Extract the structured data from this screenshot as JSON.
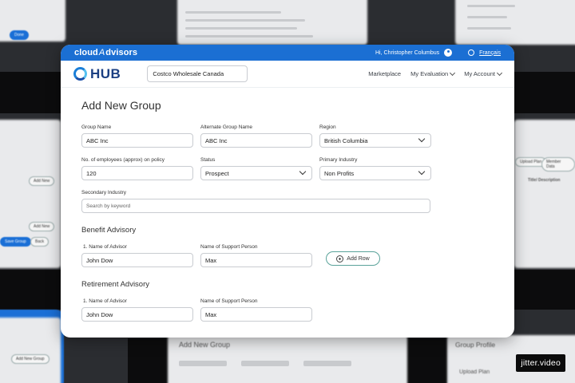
{
  "topbar": {
    "brand_cloud": "cloud",
    "brand_a": "A",
    "brand_rest": "dvisors",
    "greeting": "Hi, Christopher Columbus",
    "language": "Français"
  },
  "nav": {
    "logo_text": "HUB",
    "company": "Costco Wholesale Canada",
    "links": [
      "Marketplace",
      "My Evaluation",
      "My Account"
    ]
  },
  "page": {
    "title": "Add New Group"
  },
  "form": {
    "group_name": {
      "label": "Group Name",
      "value": "ABC Inc"
    },
    "alt_group_name": {
      "label": "Alternate Group Name",
      "value": "ABC Inc"
    },
    "region": {
      "label": "Region",
      "value": "British Columbia"
    },
    "employees": {
      "label": "No. of employees (approx) on policy",
      "value": "120"
    },
    "status": {
      "label": "Status",
      "value": "Prospect"
    },
    "primary_industry": {
      "label": "Primary Industry",
      "value": "Non Profits"
    },
    "secondary_industry": {
      "label": "Secondary Industry",
      "placeholder": "Search by keyword"
    }
  },
  "benefit": {
    "title": "Benefit Advisory",
    "advisor_label": "1. Name of Advisor",
    "advisor_value": "John Dow",
    "support_label": "Name of Support Person",
    "support_value": "Max",
    "add_row": "Add Row"
  },
  "retirement": {
    "title": "Retirement Advisory",
    "advisor_label": "1. Name of Advisor",
    "advisor_value": "John Dow",
    "support_label": "Name of Support Person",
    "support_value": "Max"
  },
  "watermark": "jitter.video",
  "background": {
    "top_left_text": "Done",
    "bottom_title": "Add New Group",
    "bottom_right_title": "Group Profile",
    "bottom_right_sub": "Upload Plan",
    "right_table_header": "Title/ Description",
    "left_add_new": "Add New",
    "left_add_group": "Add New Group",
    "upload_plan_tab": "Upload Plan",
    "member_tab": "Member Data"
  },
  "colors": {
    "brand_blue": "#1b6fd3",
    "hub_navy": "#1b3f82",
    "add_row_border": "#5aa39a"
  }
}
